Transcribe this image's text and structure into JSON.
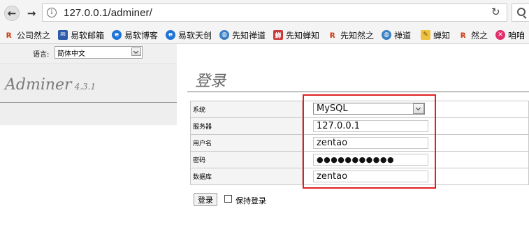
{
  "browser": {
    "url": "127.0.0.1/adminer/"
  },
  "bookmarks": [
    {
      "label": "公司然之",
      "icon": "rz-icon"
    },
    {
      "label": "易软邮箱",
      "icon": "mail-icon"
    },
    {
      "label": "易软博客",
      "icon": "blog-icon"
    },
    {
      "label": "易软天创",
      "icon": "ysoft-icon"
    },
    {
      "label": "先知禅道",
      "icon": "globe-icon"
    },
    {
      "label": "先知蝉知",
      "icon": "chanzhi-icon"
    },
    {
      "label": "先知然之",
      "icon": "rz-icon"
    },
    {
      "label": "禅道",
      "icon": "globe-icon"
    },
    {
      "label": "蝉知",
      "icon": "notepad-icon"
    },
    {
      "label": "然之",
      "icon": "rz-icon"
    },
    {
      "label": "咱咱",
      "icon": "x-icon"
    }
  ],
  "language": {
    "label": "语言:",
    "selected": "简体中文"
  },
  "brand": {
    "name": "Adminer",
    "version": "4.3.1"
  },
  "page_title": "登录",
  "form": {
    "system_label": "系统",
    "system_value": "MySQL",
    "server_label": "服务器",
    "server_value": "127.0.0.1",
    "username_label": "用户名",
    "username_value": "zentao",
    "password_label": "密码",
    "password_masked": "●●●●●●●●●●●",
    "database_label": "数据库",
    "database_value": "zentao",
    "login_button": "登录",
    "remember_label": "保持登录"
  },
  "colors": {
    "highlight": "#e02020"
  }
}
